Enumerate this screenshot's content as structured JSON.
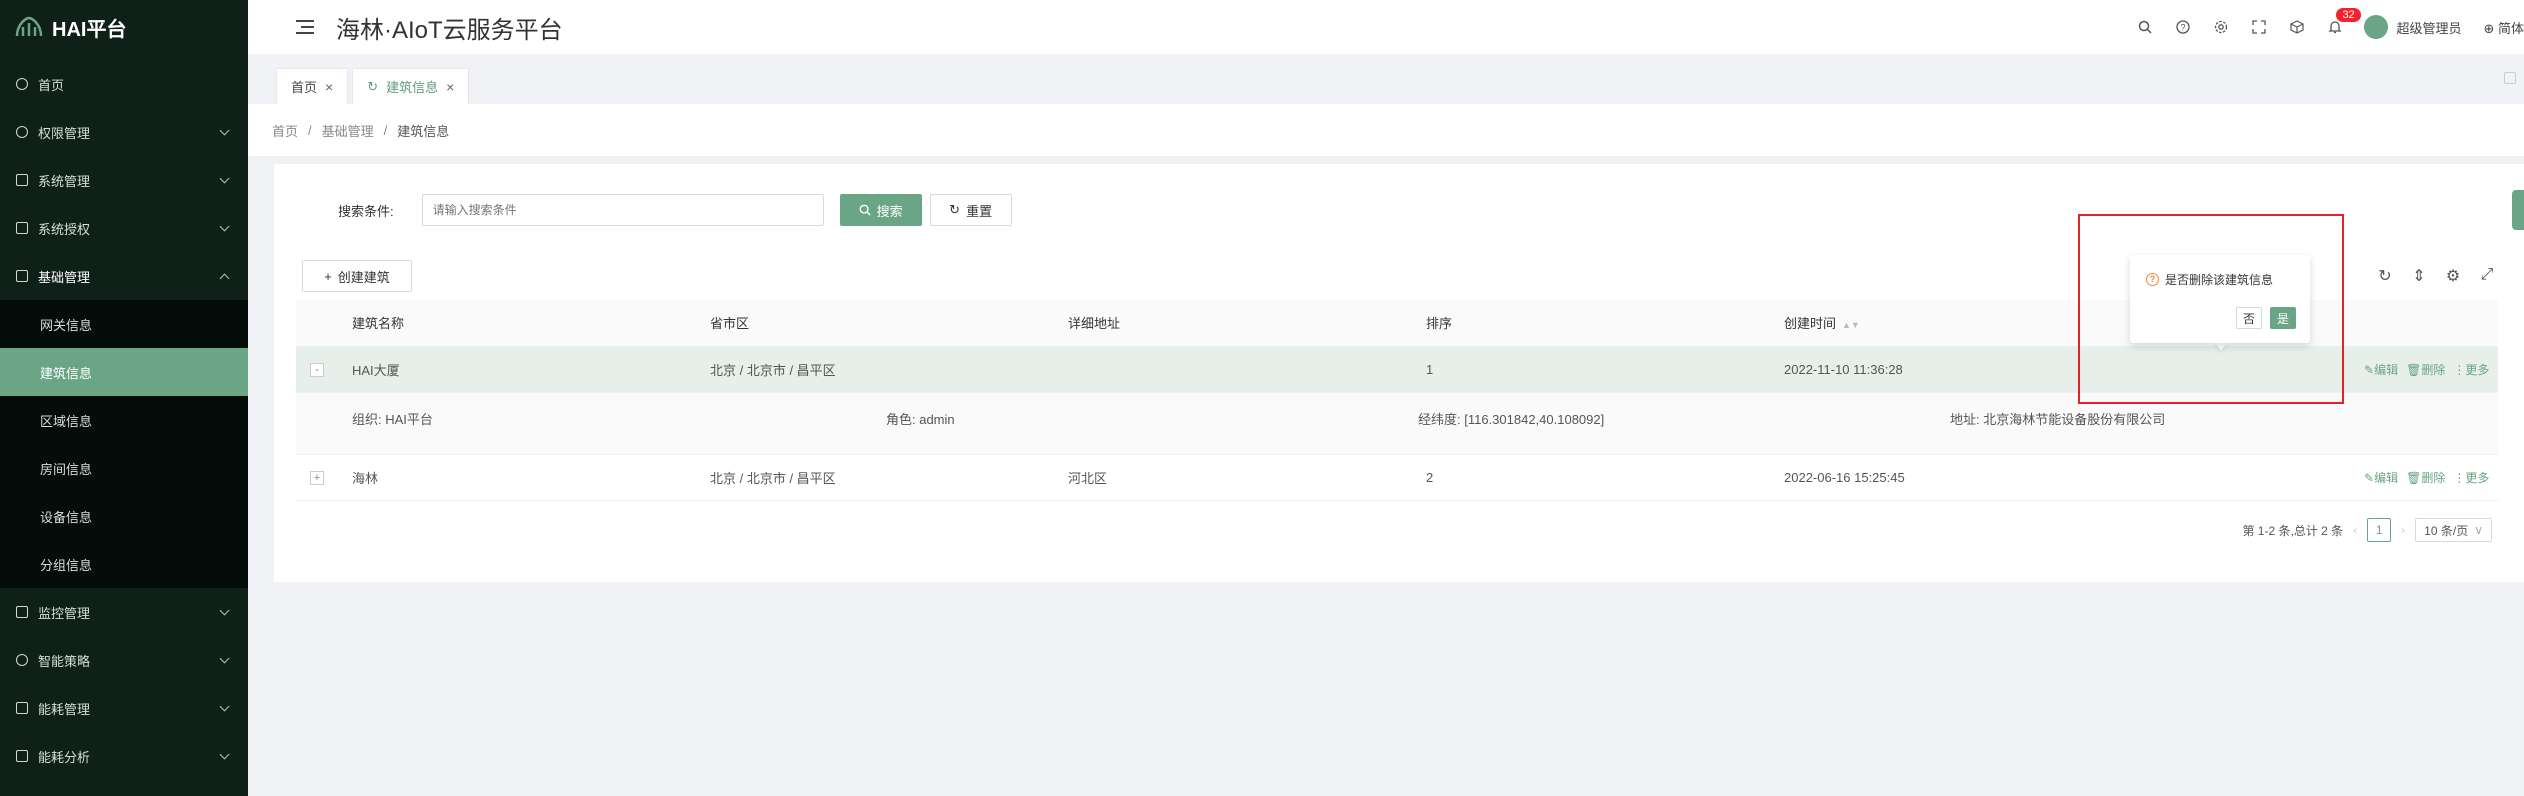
{
  "brand": {
    "name": "HAI平台"
  },
  "header": {
    "title": "海林·AIoT云服务平台",
    "notification_count": "32",
    "user_name": "超级管理员",
    "language": "简体"
  },
  "sidebar": {
    "items": [
      {
        "label": "首页",
        "icon": "home-icon"
      },
      {
        "label": "权限管理",
        "icon": "shield-icon"
      },
      {
        "label": "系统管理",
        "icon": "system-icon"
      },
      {
        "label": "系统授权",
        "icon": "license-icon"
      },
      {
        "label": "基础管理",
        "icon": "base-icon"
      },
      {
        "label": "监控管理",
        "icon": "monitor-icon"
      },
      {
        "label": "智能策略",
        "icon": "bulb-icon"
      },
      {
        "label": "能耗管理",
        "icon": "energy-icon"
      },
      {
        "label": "能耗分析",
        "icon": "chart-icon"
      }
    ],
    "sub_items": [
      {
        "label": "网关信息"
      },
      {
        "label": "建筑信息"
      },
      {
        "label": "区域信息"
      },
      {
        "label": "房间信息"
      },
      {
        "label": "设备信息"
      },
      {
        "label": "分组信息"
      }
    ]
  },
  "tabs": [
    {
      "label": "首页"
    },
    {
      "label": "建筑信息"
    }
  ],
  "breadcrumb": [
    "首页",
    "基础管理",
    "建筑信息"
  ],
  "search": {
    "label": "搜索条件:",
    "placeholder": "请输入搜索条件",
    "search_btn": "搜索",
    "reset_btn": "重置"
  },
  "create_btn": "创建建筑",
  "table": {
    "columns": [
      "建筑名称",
      "省市区",
      "详细地址",
      "排序",
      "创建时间"
    ],
    "rows": [
      {
        "name": "HAI大厦",
        "region": "北京 / 北京市 / 昌平区",
        "address": "",
        "sort": "1",
        "created": "2022-11-10 11:36:28"
      },
      {
        "name": "海林",
        "region": "北京 / 北京市 / 昌平区",
        "address": "河北区",
        "sort": "2",
        "created": "2022-06-16 15:25:45"
      }
    ],
    "detail": {
      "org": "组织:  HAI平台",
      "role": "角色:  admin",
      "coords": "经纬度:  [116.301842,40.108092]",
      "addr": "地址:  北京海林节能设备股份有限公司"
    },
    "ops": {
      "edit": "编辑",
      "delete": "删除",
      "more": "更多"
    }
  },
  "pager": {
    "summary": "第 1-2 条,总计 2 条",
    "current": "1",
    "size": "10 条/页"
  },
  "popconfirm": {
    "message": "是否删除该建筑信息",
    "no": "否",
    "yes": "是"
  }
}
